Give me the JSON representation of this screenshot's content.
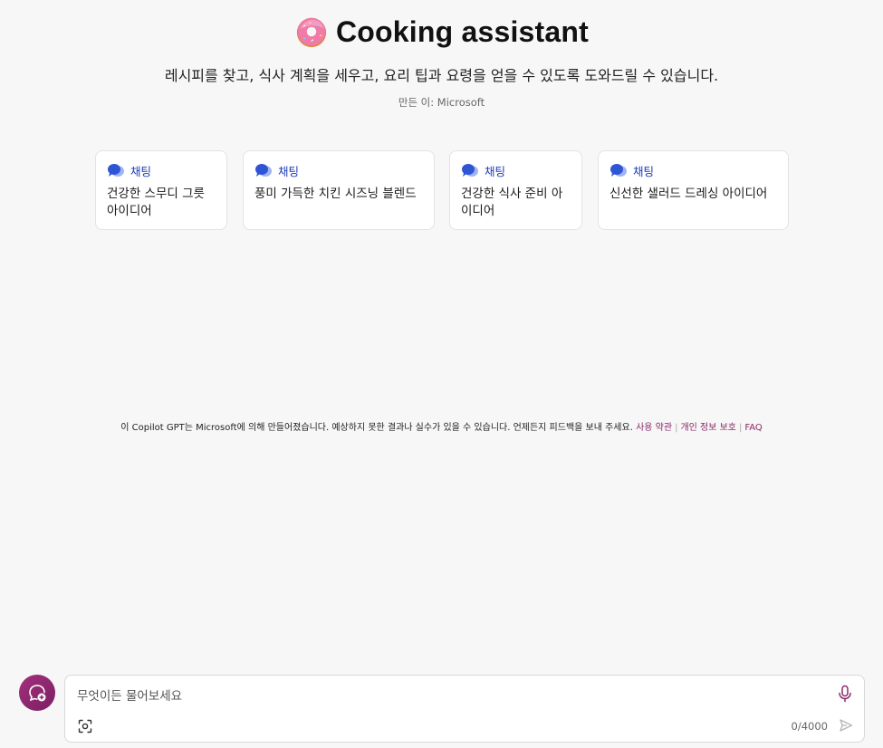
{
  "header": {
    "title": "Cooking assistant",
    "subtitle": "레시피를 찾고, 식사 계획을 세우고, 요리 팁과 요령을 얻을 수 있도록 도와드릴 수 있습니다.",
    "byline": "만든 이: Microsoft",
    "icon": "donut-icon"
  },
  "suggestions": [
    {
      "tag": "채팅",
      "text": "건강한 스무디 그릇 아이디어"
    },
    {
      "tag": "채팅",
      "text": "풍미 가득한 치킨 시즈닝 블렌드"
    },
    {
      "tag": "채팅",
      "text": "건강한 식사 준비 아이디어"
    },
    {
      "tag": "채팅",
      "text": "신선한 샐러드 드레싱 아이디어"
    }
  ],
  "footer": {
    "note": "이 Copilot GPT는 Microsoft에 의해 만들어졌습니다. 예상하지 못한 결과나 실수가 있을 수 있습니다. 언제든지 피드백을 보내 주세요.",
    "links": [
      "사용 약관",
      "개인 정보 보호",
      "FAQ"
    ]
  },
  "composer": {
    "placeholder": "무엇이든 물어보세요",
    "counter": "0/4000"
  },
  "colors": {
    "accent": "#8a2a6a",
    "tag": "#1d3bb8"
  }
}
